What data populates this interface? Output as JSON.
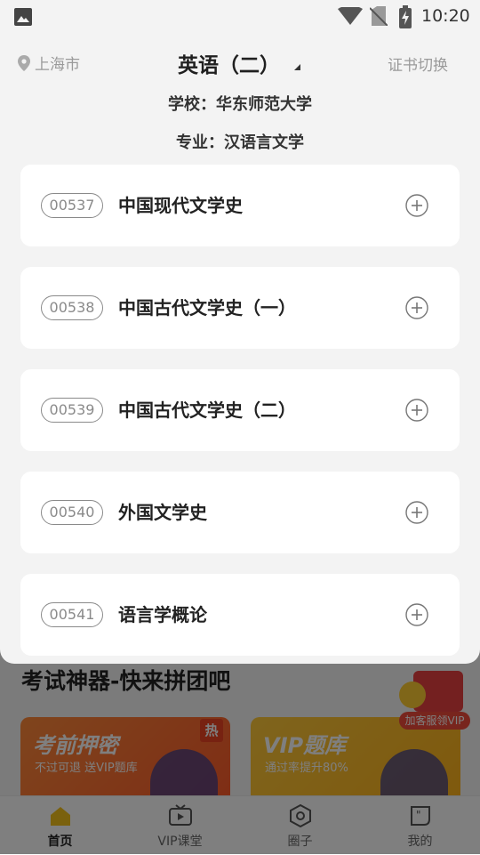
{
  "status_bar": {
    "time": "10:20"
  },
  "header": {
    "location": "上海市",
    "exam_title": "英语（二）",
    "switch_label": "证书切换"
  },
  "info": {
    "school": "学校：华东师范大学",
    "major": "专业：汉语言文学"
  },
  "courses": [
    {
      "code": "00537",
      "name": "中国现代文学史"
    },
    {
      "code": "00538",
      "name": "中国古代文学史（一）"
    },
    {
      "code": "00539",
      "name": "中国古代文学史（二）"
    },
    {
      "code": "00540",
      "name": "外国文学史"
    },
    {
      "code": "00541",
      "name": "语言学概论"
    }
  ],
  "background": {
    "section_title": "考试神器-快来拼团吧",
    "promo_left": {
      "title": "考前押密",
      "subtitle": "不过可退 送VIP题库",
      "tag": "热"
    },
    "promo_right": {
      "title": "VIP题库",
      "subtitle": "通过率提升80%"
    },
    "floating_badge": "加客服领VIP"
  },
  "tabbar": [
    {
      "label": "首页",
      "icon": "home-icon"
    },
    {
      "label": "VIP课堂",
      "icon": "tv-icon"
    },
    {
      "label": "圈子",
      "icon": "circle-icon"
    },
    {
      "label": "我的",
      "icon": "profile-icon"
    }
  ],
  "colors": {
    "accent": "#f4c21a",
    "sheet_bg": "#f3f3f3",
    "card_bg": "#ffffff",
    "overlay": "rgba(0,0,0,0.5)"
  }
}
